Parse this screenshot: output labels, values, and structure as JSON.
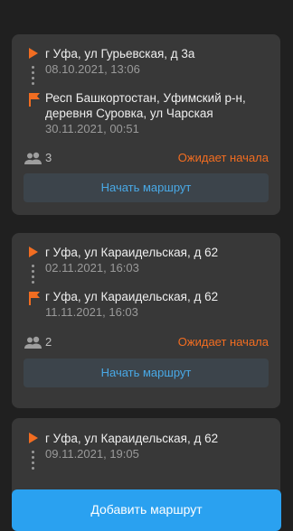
{
  "routes": [
    {
      "start_address": "г Уфа, ул Гурьевская, д 3а",
      "start_date": "08.10.2021, 13:06",
      "end_address": "Респ Башкортостан, Уфимский р-н, деревня Суровка, ул Чарская",
      "end_date": "30.11.2021, 00:51",
      "passengers": "3",
      "status": "Ожидает начала",
      "button_label": "Начать маршрут"
    },
    {
      "start_address": "г Уфа, ул Караидельская, д 62",
      "start_date": "02.11.2021, 16:03",
      "end_address": "г Уфа, ул Караидельская, д 62",
      "end_date": "11.11.2021, 16:03",
      "passengers": "2",
      "status": "Ожидает начала",
      "button_label": "Начать маршрут"
    },
    {
      "start_address": "г Уфа, ул Караидельская, д 62",
      "start_date": "09.11.2021, 19:05"
    }
  ],
  "add_button_label": "Добавить маршрут",
  "colors": {
    "accent_orange": "#f26d21",
    "accent_blue": "#2aa1f0",
    "card_bg": "#383838",
    "page_bg": "#202020"
  },
  "icons": {
    "start": "start-triangle-icon",
    "finish": "finish-flag-icon",
    "passengers": "people-icon"
  }
}
